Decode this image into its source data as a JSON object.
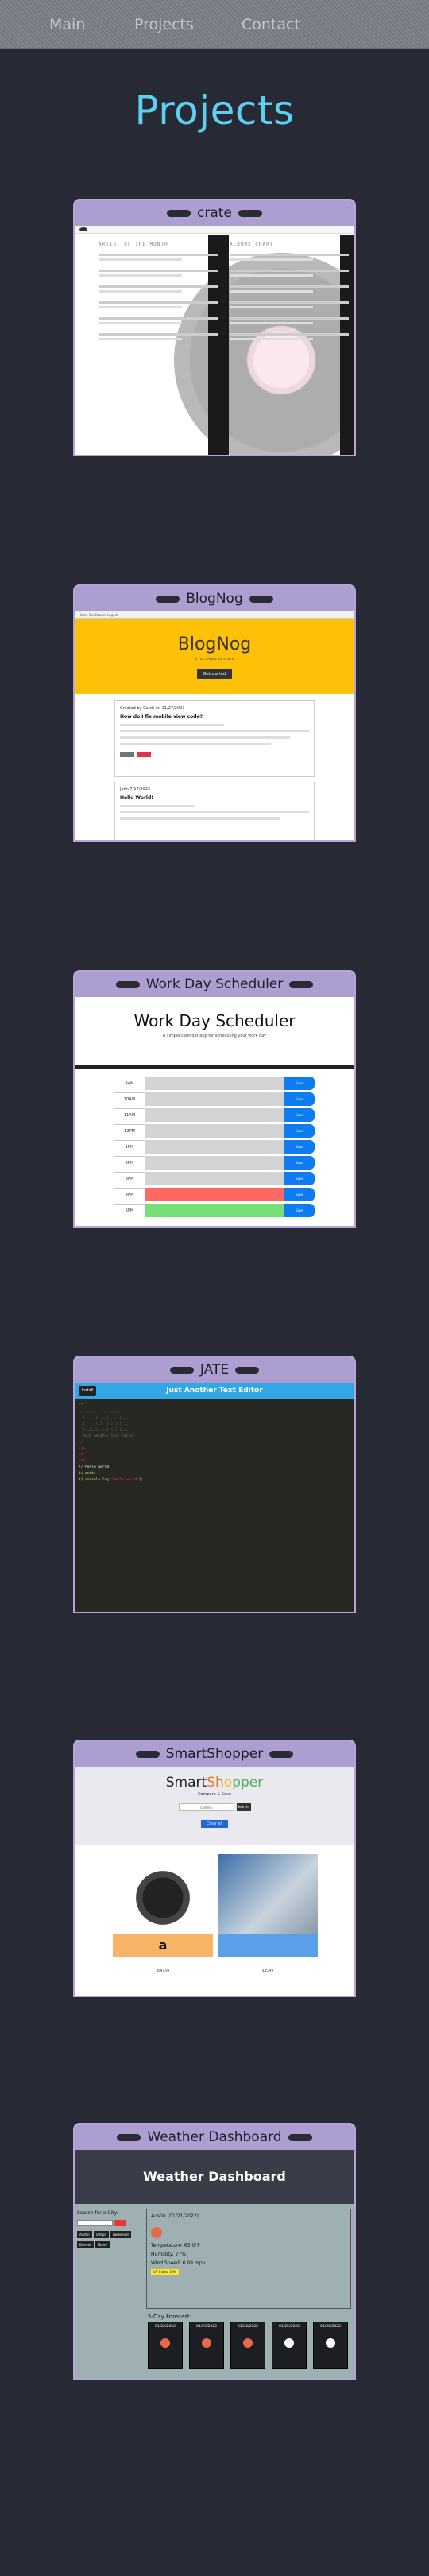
{
  "nav": {
    "items": [
      "Main",
      "Projects",
      "Contact"
    ]
  },
  "page": {
    "title": "Projects"
  },
  "projects": [
    {
      "title": "crate",
      "screenshot": {
        "left_header": "ARTIST OF THE MONTH",
        "right_header": "ALBUMS CHART"
      }
    },
    {
      "title": "BlogNog",
      "screenshot": {
        "nav": "Home   Dashboard   Logout",
        "hero_title": "BlogNog",
        "hero_sub": "a fun place to share",
        "hero_button": "Get started",
        "post1_meta": "Created by Caleb on 11/27/2023",
        "post1_title": "How do I fix mobile view code?",
        "post2_meta": "John   7/17/2023",
        "post2_title": "Hello World!"
      }
    },
    {
      "title": "Work Day Scheduler",
      "screenshot": {
        "heading": "Work Day Scheduler",
        "subheading": "A simple calendar app for scheduling your work day",
        "hours": [
          "9AM",
          "10AM",
          "11AM",
          "12PM",
          "1PM",
          "2PM",
          "3PM",
          "4PM",
          "5PM"
        ],
        "save_label": "Save"
      }
    },
    {
      "title": "JATE",
      "screenshot": {
        "install": "Install",
        "header": "Just Another Text Editor"
      }
    },
    {
      "title": "SmartShopper",
      "screenshot": {
        "brand_a": "Smart",
        "brand_b": "Sh",
        "brand_c": "o",
        "brand_d": "pper",
        "tagline": "Compare & Save",
        "search_value": "camera",
        "search_button": "Search!",
        "clear_button": "Clear all",
        "store_a": "a",
        "price_a": "$697.99",
        "price_b": "$45.99"
      }
    },
    {
      "title": "Weather Dashboard",
      "screenshot": {
        "header": "Weather Dashboard",
        "search_label": "Search for a City:",
        "history": [
          "Austin",
          "Tampa",
          "Lakewood",
          "Denver",
          "Miami"
        ],
        "city": "Austin (01/21/2022)",
        "temp": "Temperature: 63.0°F",
        "humidity": "Humidity: 77%",
        "wind": "Wind Speed: 6.08 mph",
        "uv": "UV Index: 2.94",
        "forecast_title": "5-Day Forecast:",
        "forecast_dates": [
          "01/22/2022",
          "01/23/2022",
          "01/24/2022",
          "01/25/2022",
          "01/26/2022"
        ],
        "forecast_colors": [
          "#e56a4b",
          "#e56a4b",
          "#e56a4b",
          "#ffffff",
          "#ffffff"
        ]
      }
    }
  ]
}
